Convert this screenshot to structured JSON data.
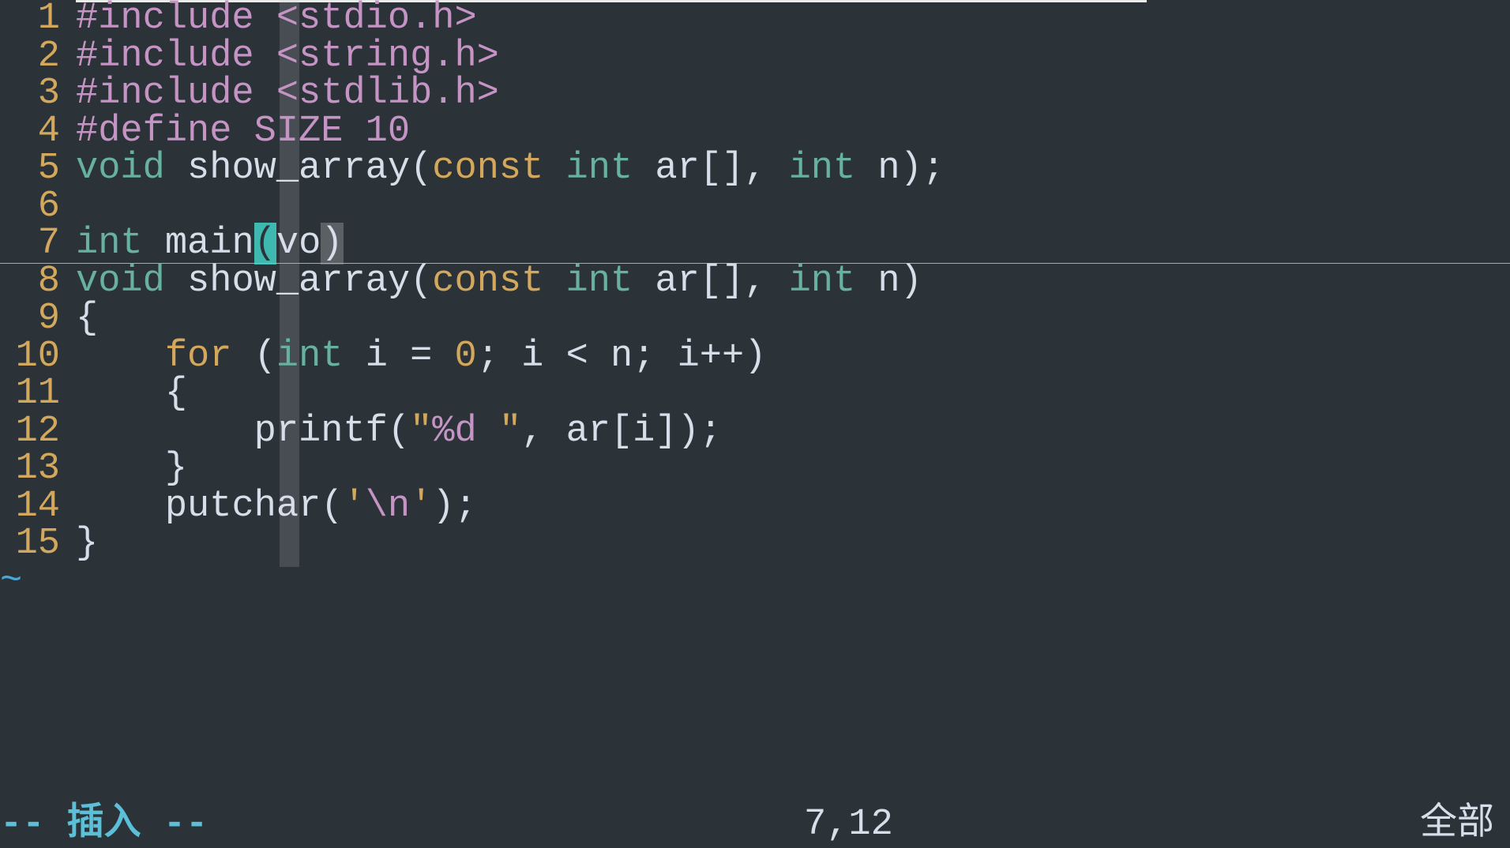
{
  "lines": {
    "ln1": "1",
    "ln2": "2",
    "ln3": "3",
    "ln4": "4",
    "ln5": "5",
    "ln6": "6",
    "ln7": "7",
    "ln8": "8",
    "ln9": "9",
    "ln10": "10",
    "ln11": "11",
    "ln12": "12",
    "ln13": "13",
    "ln14": "14",
    "ln15": "15"
  },
  "code": {
    "l1_include": "#include ",
    "l1_header": "<stdio.h>",
    "l2_include": "#include ",
    "l2_header": "<string.h>",
    "l3_include": "#include ",
    "l3_header": "<stdlib.h>",
    "l4_define": "#define SIZE ",
    "l4_value": "10",
    "l5_void": "void ",
    "l5_func": "show_array",
    "l5_op": "(",
    "l5_const": "const ",
    "l5_int1": "int ",
    "l5_ar": "ar[], ",
    "l5_int2": "int ",
    "l5_n": "n);",
    "l7_int": "int ",
    "l7_main": "main",
    "l7_p1": "(",
    "l7_vo": "vo",
    "l7_p2": ")",
    "l8_void": "void ",
    "l8_func": "show_array",
    "l8_op": "(",
    "l8_const": "const ",
    "l8_int1": "int ",
    "l8_ar": "ar[], ",
    "l8_int2": "int ",
    "l8_n": "n)",
    "l9_brace": "{",
    "l10_indent": "    ",
    "l10_for": "for ",
    "l10_p1": "(",
    "l10_int": "int ",
    "l10_expr1": "i = ",
    "l10_zero": "0",
    "l10_expr2": "; i < n; i++)",
    "l11_brace": "    {",
    "l12_indent": "        ",
    "l12_printf": "printf(",
    "l12_q1": "\"",
    "l12_fmt": "%d",
    "l12_sp": " ",
    "l12_q2": "\"",
    "l12_rest": ", ar[i]);",
    "l13_brace": "    }",
    "l14_indent": "    ",
    "l14_putchar": "putchar(",
    "l14_q1": "'",
    "l14_esc": "\\n",
    "l14_q2": "'",
    "l14_rest": ");",
    "l15_brace": "}"
  },
  "tilde": "~",
  "status": {
    "mode": "-- 插入 --",
    "position": "7,12",
    "percent": "全部"
  }
}
